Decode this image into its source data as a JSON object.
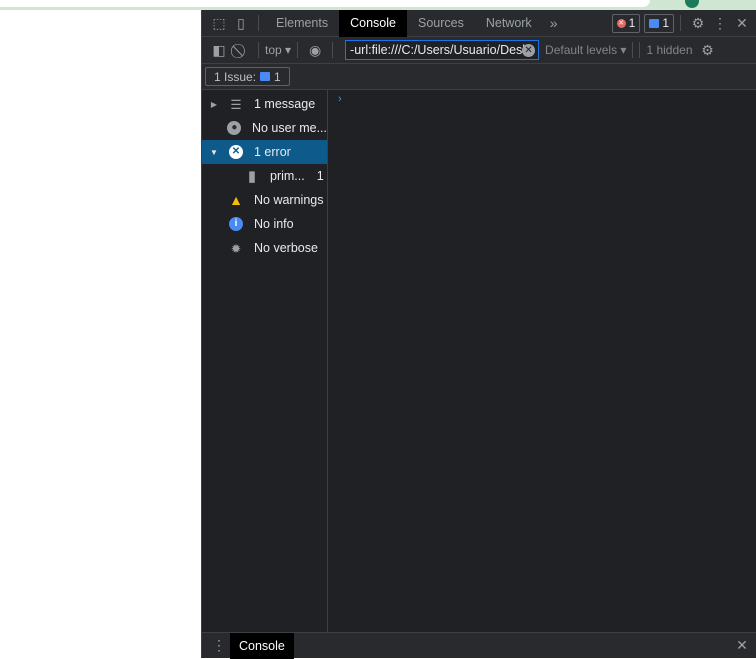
{
  "devtools": {
    "tabs": [
      {
        "label": "Elements"
      },
      {
        "label": "Console",
        "active": true
      },
      {
        "label": "Sources"
      },
      {
        "label": "Network"
      }
    ],
    "more_tabs": "»",
    "error_count": "1",
    "message_count": "1",
    "toolbar": {
      "context": "top",
      "filter_value": "-url:file:///C:/Users/Usuario/Desk",
      "levels": "Default levels",
      "hidden": "1 hidden"
    },
    "issues": {
      "label": "1 Issue:",
      "count": "1"
    },
    "sidebar": [
      {
        "label": "1 message",
        "icon": "list-icon"
      },
      {
        "label": "No user me...",
        "icon": "user-icon"
      },
      {
        "label": "1 error",
        "icon": "error-icon",
        "selected": true
      },
      {
        "label": "prim...",
        "count": "1",
        "icon": "file-icon"
      },
      {
        "label": "No warnings",
        "icon": "warning-icon"
      },
      {
        "label": "No info",
        "icon": "info-icon"
      },
      {
        "label": "No verbose",
        "icon": "bug-icon"
      }
    ],
    "prompt": "›",
    "drawer": {
      "tab": "Console"
    },
    "colors": {
      "accent": "#1a73e8",
      "selected": "#0e5a8a",
      "error": "#e46962",
      "warning": "#fbbc04",
      "info": "#4a8af4"
    }
  }
}
